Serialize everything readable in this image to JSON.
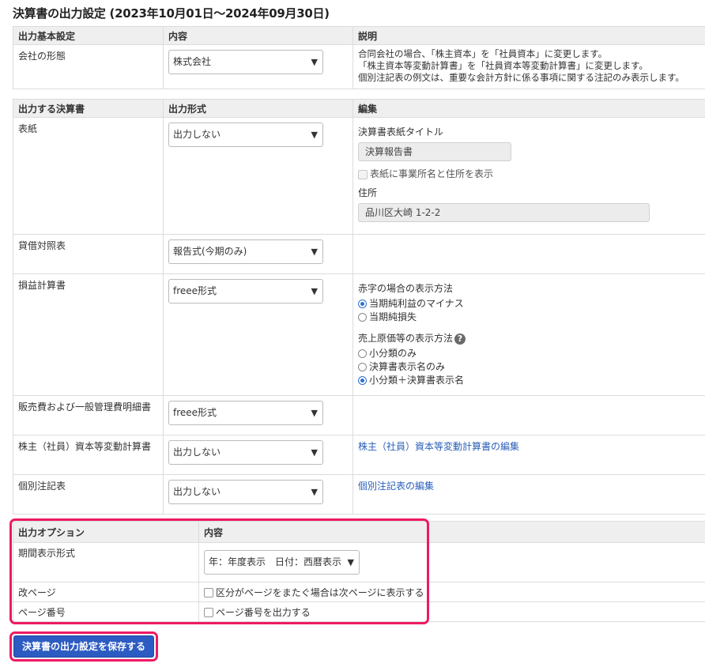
{
  "page_title": "決算書の出力設定 (2023年10月01日〜2024年09月30日)",
  "basic": {
    "headers": [
      "出力基本設定",
      "内容",
      "説明"
    ],
    "company_label": "会社の形態",
    "company_value": "株式会社",
    "desc": [
      "合同会社の場合、「株主資本」を「社員資本」に変更します。",
      "「株主資本等変動計算書」を「社員資本等変動計算書」に変更します。",
      "個別注記表の例文は、重要な会計方針に係る事項に関する注記のみ表示します。"
    ]
  },
  "statements": {
    "headers": [
      "出力する決算書",
      "出力形式",
      "編集"
    ],
    "cover": {
      "label": "表紙",
      "format": "出力しない",
      "title_label": "決算書表紙タイトル",
      "title_value": "決算報告書",
      "show_address_label": "表紙に事業所名と住所を表示",
      "address_label": "住所",
      "address_value": "品川区大崎 1-2-2"
    },
    "bs": {
      "label": "貸借対照表",
      "format": "報告式(今期のみ)"
    },
    "pl": {
      "label": "損益計算書",
      "format": "freee形式",
      "red_label": "赤字の場合の表示方法",
      "red_options": [
        "当期純利益のマイナス",
        "当期純損失"
      ],
      "red_selected": 0,
      "cogs_label": "売上原価等の表示方法",
      "cogs_options": [
        "小分類のみ",
        "決算書表示名のみ",
        "小分類＋決算書表示名"
      ],
      "cogs_selected": 2
    },
    "sga": {
      "label": "販売費および一般管理費明細書",
      "format": "freee形式"
    },
    "equity": {
      "label": "株主（社員）資本等変動計算書",
      "format": "出力しない",
      "edit_link": "株主（社員）資本等変動計算書の編集"
    },
    "notes": {
      "label": "個別注記表",
      "format": "出力しない",
      "edit_link": "個別注記表の編集"
    }
  },
  "options": {
    "headers": [
      "出力オプション",
      "内容"
    ],
    "period": {
      "label": "期間表示形式",
      "value": "年：年度表示　日付：西暦表示"
    },
    "pagebreak": {
      "label": "改ページ",
      "checkbox": "区分がページをまたぐ場合は次ページに表示する"
    },
    "pagenum": {
      "label": "ページ番号",
      "checkbox": "ページ番号を出力する"
    }
  },
  "save_button": "決算書の出力設定を保存する",
  "icons": {
    "select": "chevron-down-icon",
    "help": "question-circle-icon"
  },
  "colors": {
    "highlight": "#ee1a63",
    "primary": "#2c5bc2",
    "link": "#2a5fb8"
  }
}
